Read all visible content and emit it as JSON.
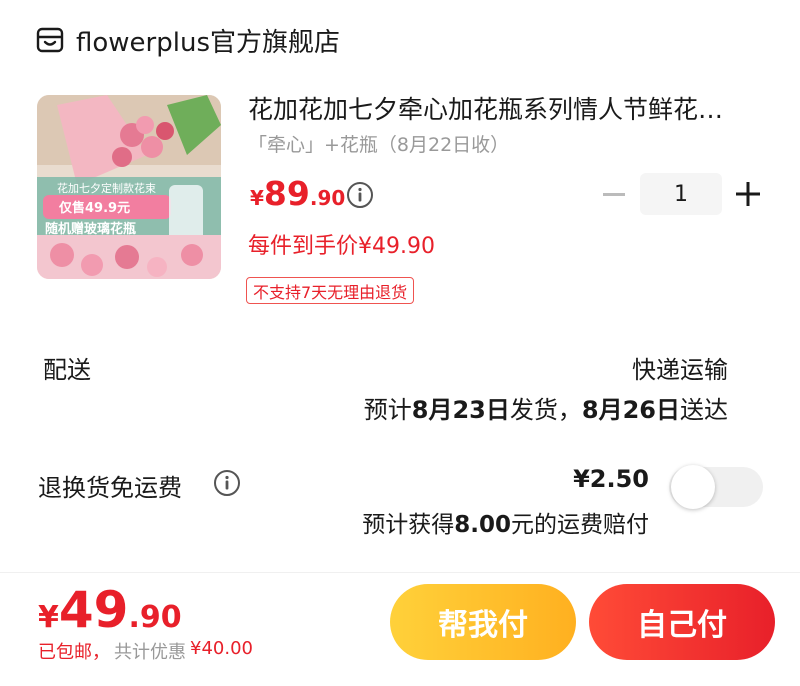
{
  "store": {
    "name": "flowerplus官方旗舰店",
    "icon": "store-icon"
  },
  "product": {
    "title": "花加花加七夕牵心加花瓶系列情人节鲜花…",
    "spec": "「牵心」+花瓶（8月22日收）",
    "price": {
      "symbol": "¥",
      "integer": "89",
      "decimal": ".90"
    },
    "unit_price_text": "每件到手价¥49.90",
    "return_policy": "不支持7天无理由退货",
    "image_overlay": {
      "line1": "花加七夕定制款花束",
      "line2": "仅售49.9元",
      "line3": "随机赠玻璃花瓶"
    },
    "quantity": "1"
  },
  "shipping": {
    "label": "配送",
    "method": "快递运输",
    "date_prefix": "预计",
    "ship_day": "8月23日",
    "ship_mid": "发货，",
    "arrive_day": "8月26日",
    "arrive_suffix": "送达"
  },
  "insurance": {
    "label": "退换货免运费",
    "price": "¥2.50",
    "desc_prefix": "预计获得",
    "desc_amount": "8.00",
    "desc_suffix": "元的运费赔付",
    "enabled": false
  },
  "footer": {
    "total": {
      "symbol": "¥",
      "integer": "49",
      "decimal": ".90"
    },
    "free_shipping": "已包邮，",
    "discount_label": "共计优惠",
    "discount_amount": "¥40.00",
    "help_pay_label": "帮我付",
    "self_pay_label": "自己付"
  },
  "colors": {
    "accent_red": "#e8202a",
    "help_button_yellow": "#ffc12e",
    "muted_gray": "#999999"
  }
}
